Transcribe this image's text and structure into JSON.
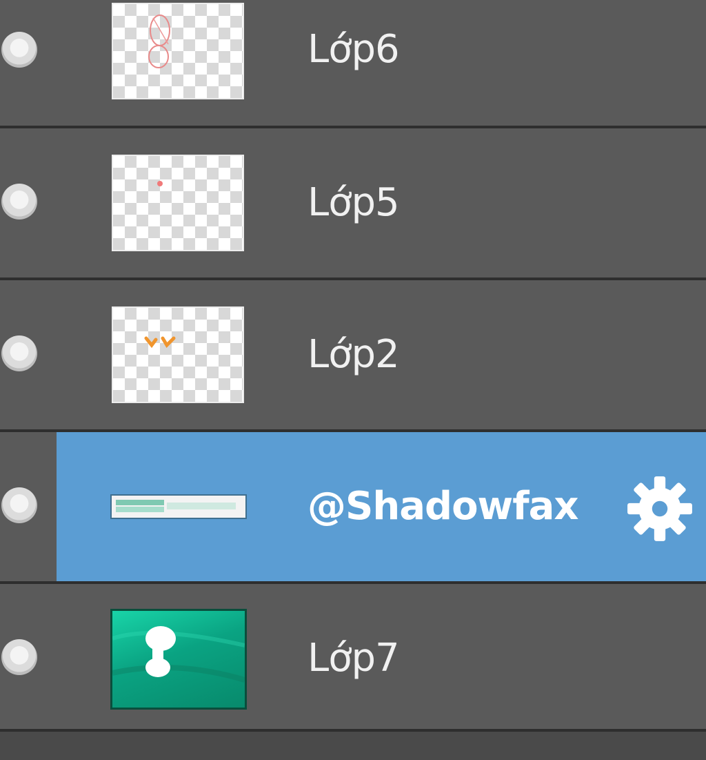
{
  "layers_panel": {
    "layers": [
      {
        "name": "Lớp6",
        "thumbnail": "transparent-with-red-sketch",
        "selected": false
      },
      {
        "name": "Lớp5",
        "thumbnail": "transparent-with-red-dot",
        "selected": false
      },
      {
        "name": "Lớp2",
        "thumbnail": "transparent-with-orange-marks",
        "selected": false
      },
      {
        "name": "@Shadowfax",
        "thumbnail": "text-strip",
        "selected": true,
        "icon": "gear-icon"
      },
      {
        "name": "Lớp7",
        "thumbnail": "teal-background-with-white-figure",
        "selected": false
      }
    ],
    "colors": {
      "panel_bg": "#5a5a5a",
      "separator": "#2e2e2e",
      "selected_bg": "#5b9dd3",
      "text": "#f1f1f1"
    }
  }
}
